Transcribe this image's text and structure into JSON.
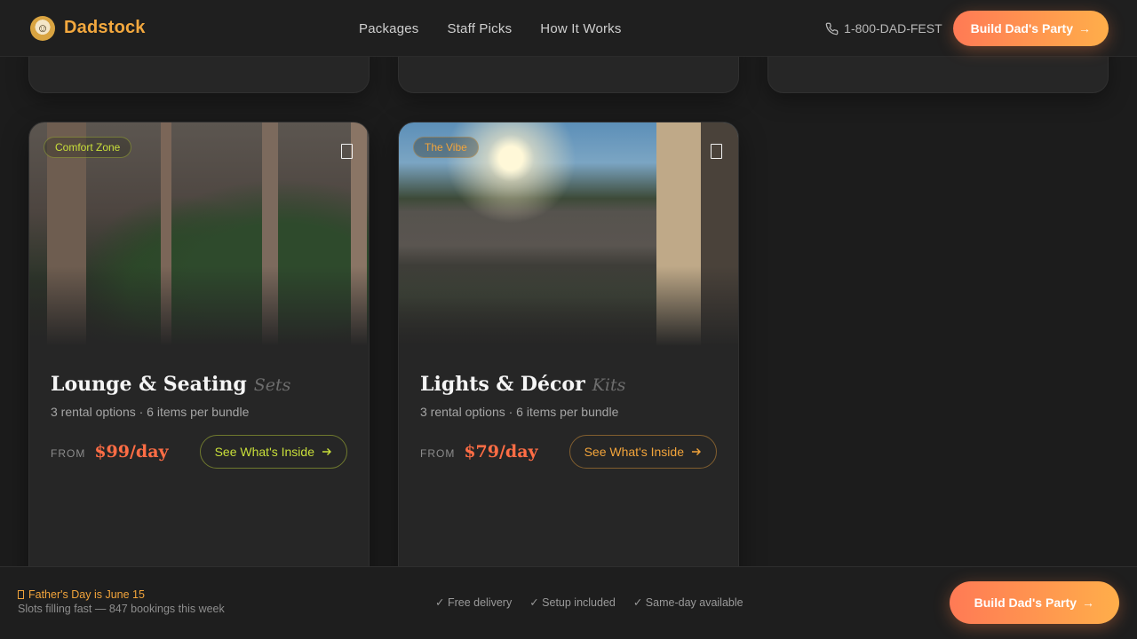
{
  "header": {
    "brand": "Dadstock",
    "nav": [
      "Packages",
      "Staff Picks",
      "How It Works"
    ],
    "phone": "1-800-DAD-FEST",
    "cta_label": "Build Dad's Party",
    "cta_arrow": "→"
  },
  "cards": [
    {
      "badge": "Comfort Zone",
      "title": "Lounge & Seating",
      "subtitle": "Sets",
      "meta": "3 rental options · 6 items per bundle",
      "from": "FROM",
      "price": "$99/day",
      "button": "See What's Inside",
      "accent": "#c9df3a"
    },
    {
      "badge": "The Vibe",
      "title": "Lights & Décor",
      "subtitle": "Kits",
      "meta": "3 rental options · 6 items per bundle",
      "from": "FROM",
      "price": "$79/day",
      "button": "See What's Inside",
      "accent": "#f2a43b"
    }
  ],
  "footer": {
    "promo": "Father's Day is June 15",
    "subpromo": "Slots filling fast — 847 bookings this week",
    "perks": [
      "✓ Free delivery",
      "✓ Setup included",
      "✓ Same-day available"
    ],
    "cta_label": "Build Dad's Party",
    "cta_arrow": "→"
  },
  "colors": {
    "background": "#1c1c1c",
    "brand": "#f3a83e",
    "price": "#ff6d45",
    "cta_start": "#ff7a55",
    "cta_end": "#ffae4a"
  },
  "icons": [
    "brand-logo-icon",
    "phone-icon",
    "bookmark-icon",
    "arrow-right-icon",
    "calendar-icon"
  ]
}
